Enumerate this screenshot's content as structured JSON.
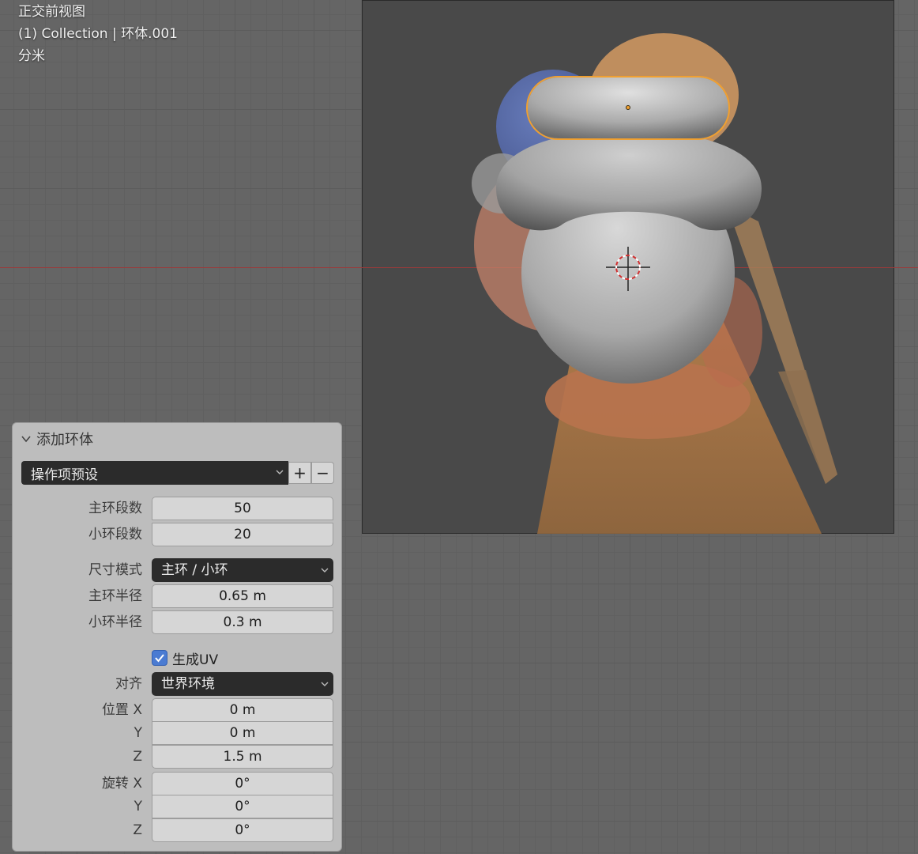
{
  "viewport": {
    "view_name": "正交前视图",
    "collection_line": "(1) Collection | 环体.001",
    "units": "分米"
  },
  "operator_panel": {
    "title": "添加环体",
    "preset_label": "操作项预设",
    "add_preset_symbol": "+",
    "remove_preset_symbol": "−",
    "major_segments": {
      "label": "主环段数",
      "value": "50"
    },
    "minor_segments": {
      "label": "小环段数",
      "value": "20"
    },
    "dimensions_mode": {
      "label": "尺寸模式",
      "value": "主环 / 小环"
    },
    "major_radius": {
      "label": "主环半径",
      "value": "0.65 m"
    },
    "minor_radius": {
      "label": "小环半径",
      "value": "0.3 m"
    },
    "generate_uv": {
      "label": "生成UV",
      "checked": true
    },
    "align": {
      "label": "对齐",
      "value": "世界环境"
    },
    "location": {
      "label": "位置 X",
      "y_label": "Y",
      "z_label": "Z",
      "x": "0 m",
      "y": "0 m",
      "z": "1.5 m"
    },
    "rotation": {
      "label": "旋转 X",
      "y_label": "Y",
      "z_label": "Z",
      "x": "0°",
      "y": "0°",
      "z": "0°"
    }
  },
  "colors": {
    "viewport_bg": "#656565",
    "camera_frame_bg": "#494949",
    "selection_outline": "#f0a030",
    "x_axis": "#9a3a3a",
    "panel_bg": "#bdbdbd",
    "checkbox_blue": "#4a7bd2"
  }
}
